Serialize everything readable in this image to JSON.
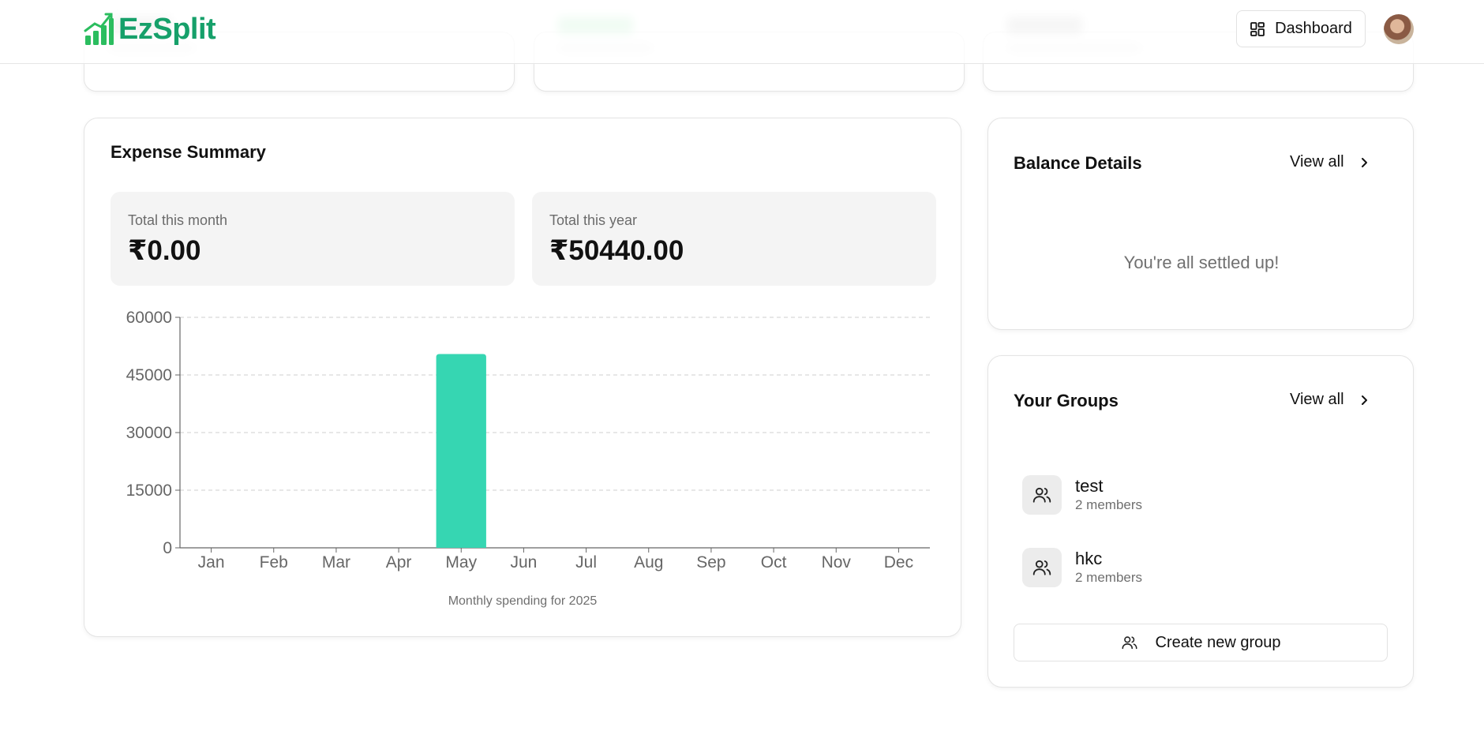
{
  "header": {
    "brand": "EzSplit",
    "dashboard_label": "Dashboard"
  },
  "expense_summary": {
    "title": "Expense Summary",
    "month_label": "Total this month",
    "month_value": "₹0.00",
    "year_label": "Total this year",
    "year_value": "₹50440.00",
    "caption": "Monthly spending for 2025"
  },
  "chart_data": {
    "type": "bar",
    "categories": [
      "Jan",
      "Feb",
      "Mar",
      "Apr",
      "May",
      "Jun",
      "Jul",
      "Aug",
      "Sep",
      "Oct",
      "Nov",
      "Dec"
    ],
    "values": [
      0,
      0,
      0,
      0,
      50440,
      0,
      0,
      0,
      0,
      0,
      0,
      0
    ],
    "yticks": [
      0,
      15000,
      30000,
      45000,
      60000
    ],
    "ylim": [
      0,
      60000
    ],
    "grid": true,
    "bar_color": "#36d6b2"
  },
  "balance": {
    "title": "Balance Details",
    "view_all": "View all",
    "empty_text": "You're all settled up!"
  },
  "groups": {
    "title": "Your Groups",
    "view_all": "View all",
    "items": [
      {
        "name": "test",
        "members": "2 members"
      },
      {
        "name": "hkc",
        "members": "2 members"
      }
    ],
    "create_label": "Create new group"
  },
  "colors": {
    "brand": "#16a06a",
    "bar": "#36d6b2"
  }
}
